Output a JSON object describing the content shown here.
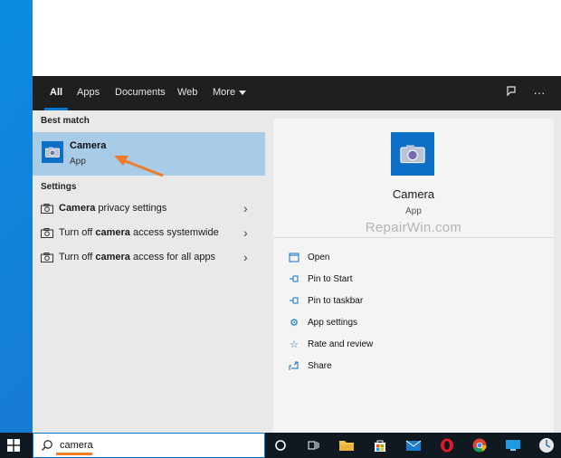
{
  "tabs": [
    {
      "label": "All",
      "active": true
    },
    {
      "label": "Apps"
    },
    {
      "label": "Documents"
    },
    {
      "label": "Web"
    },
    {
      "label": "More"
    }
  ],
  "tabbar_icons": [
    "feedback-icon",
    "more-options-icon"
  ],
  "best_match": {
    "section_label": "Best match",
    "title": "Camera",
    "subtitle": "App",
    "icon": "camera-icon"
  },
  "settings": {
    "section_label": "Settings",
    "items": [
      {
        "pre": "",
        "bold": "Camera",
        "post": " privacy settings"
      },
      {
        "pre": "Turn off ",
        "bold": "camera",
        "post": " access systemwide"
      },
      {
        "pre": "Turn off ",
        "bold": "camera",
        "post": " access for all apps"
      }
    ]
  },
  "preview": {
    "title": "Camera",
    "subtitle": "App",
    "watermark": "RepairWin.com",
    "actions": [
      {
        "label": "Open",
        "icon": "open-icon"
      },
      {
        "label": "Pin to Start",
        "icon": "pin-icon"
      },
      {
        "label": "Pin to taskbar",
        "icon": "pin-icon"
      },
      {
        "label": "App settings",
        "icon": "gear-icon"
      },
      {
        "label": "Rate and review",
        "icon": "star-icon"
      },
      {
        "label": "Share",
        "icon": "share-icon"
      }
    ]
  },
  "taskbar": {
    "search_query": "camera",
    "apps": [
      "cortana-icon",
      "task-view-icon",
      "file-explorer-icon",
      "store-icon",
      "mail-icon",
      "opera-icon",
      "chrome-icon",
      "display-icon",
      "clock-icon"
    ]
  },
  "colors": {
    "accent": "#0078d7",
    "highlight": "#a8cbe8",
    "annotation": "#f07b2a"
  }
}
